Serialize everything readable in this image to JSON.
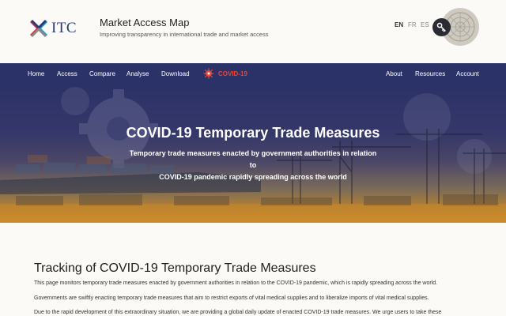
{
  "header": {
    "logo_text": "ITC",
    "site_title": "Market Access Map",
    "tagline": "Improving transparency in international trade and market access",
    "languages": [
      {
        "code": "EN",
        "active": true
      },
      {
        "code": "FR",
        "active": false
      },
      {
        "code": "ES",
        "active": false
      }
    ]
  },
  "nav": {
    "left": [
      "Home",
      "Access",
      "Compare",
      "Analyse",
      "Download"
    ],
    "covid": "COVID-19",
    "right": [
      "About",
      "Resources",
      "Account"
    ]
  },
  "hero": {
    "title": "COVID-19 Temporary Trade Measures",
    "subtitle_line1": "Temporary trade measures enacted by government authorities in relation to",
    "subtitle_line2": "COVID-19 pandemic rapidly spreading across the world"
  },
  "content": {
    "title": "Tracking of COVID-19 Temporary Trade Measures",
    "paragraphs": [
      "This page monitors temporary trade measures enacted by government authorities in relation to the COVID-19 pandemic, which is rapidly spreading across the world.",
      "Governments are swiftly enacting temporary trade measures that aim to restrict exports of vital medical supplies and to liberalize imports of vital medical supplies.",
      "Due to the rapid development of this extraordinary situation, we are providing a global daily update of enacted COVID-19 trade measures. We urge users to take these"
    ]
  },
  "colors": {
    "nav_bg": "#2a3268",
    "covid_red": "#e4473d",
    "logo_blue": "#2a3a78",
    "page_bg": "#fbfaf6"
  },
  "icons": [
    "itc-logo-icon",
    "key-icon",
    "un-emblem-icon",
    "coronavirus-icon",
    "gear-icon"
  ]
}
